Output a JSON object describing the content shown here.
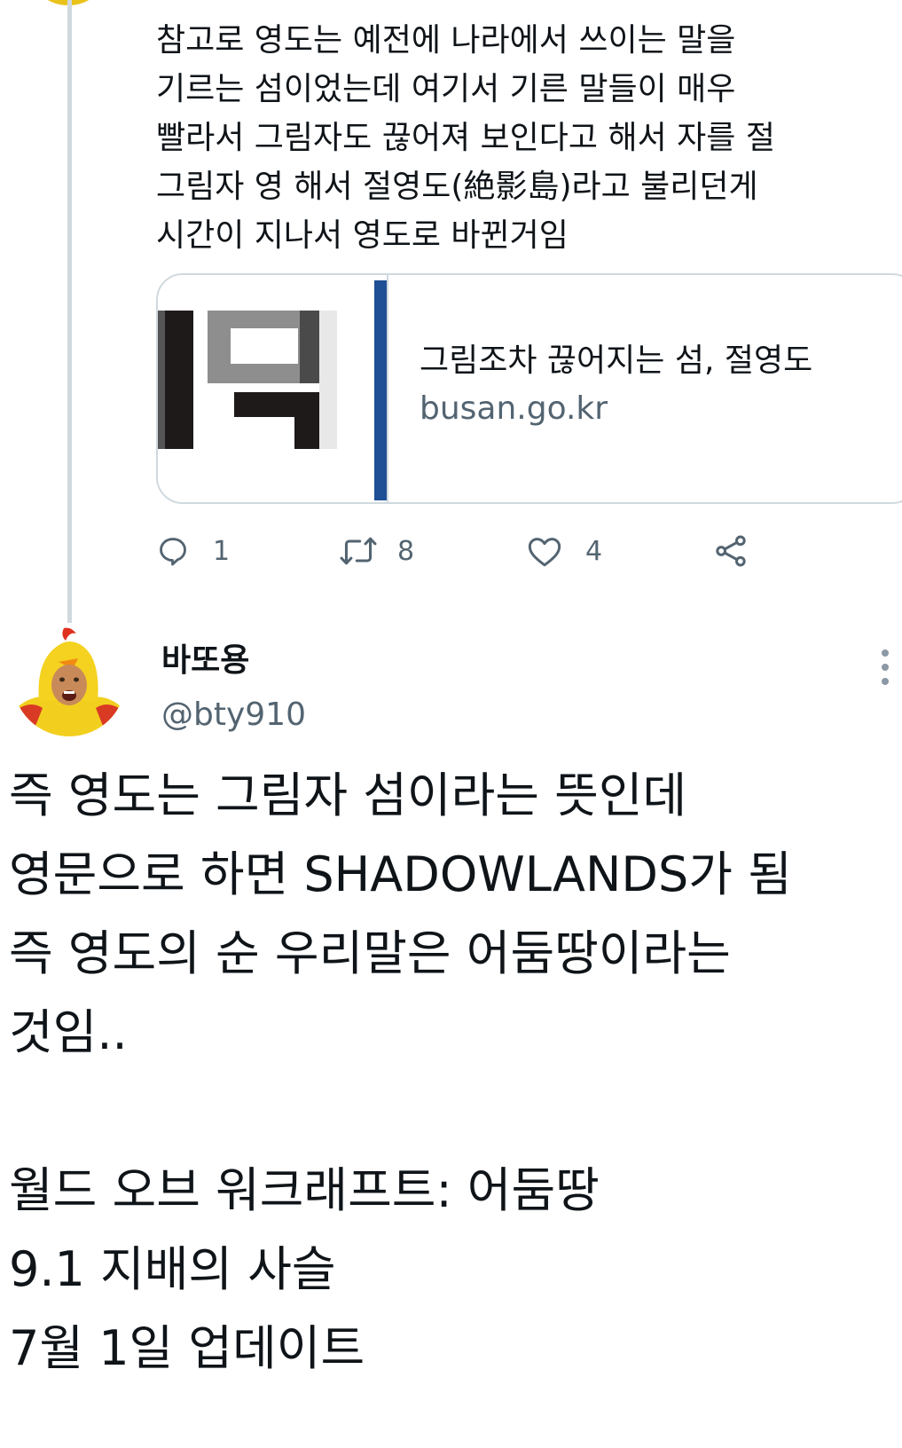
{
  "reply_context": {
    "text": "참고로 영도는 예전에 나라에서 쓰이는 말을\n기르는 섬이었는데 여기서 기른 말들이 매우\n빨라서 그림자도 끊어져 보인다고 해서 자를 절\n그림자 영 해서 절영도(絶影島)라고 불리던게\n시간이 지나서 영도로 바뀐거임",
    "link_card": {
      "title": "그림조차 끊어지는 섬, 절영도",
      "domain": "busan.go.kr"
    },
    "actions": {
      "reply_count": "1",
      "retweet_count": "8",
      "like_count": "4"
    }
  },
  "tweet": {
    "author_name": "바또용",
    "author_handle": "@bty910",
    "text": "즉 영도는 그림자 섬이라는 뜻인데\n영문으로 하면 SHADOWLANDS가 됨\n즉 영도의 순 우리말은 어둠땅이라는\n것임..\n\n월드 오브 워크래프트: 어둠땅\n9.1 지배의 사슬\n7월 1일 업데이트"
  },
  "icons": {
    "reply": "speech-bubble-icon",
    "retweet": "retweet-arrows-icon",
    "like": "heart-icon",
    "share": "share-icon",
    "more": "vertical-dots-icon"
  },
  "colors": {
    "text": "#0f1419",
    "secondary": "#536471",
    "border": "#cfd9de",
    "thumb_accent": "#1f4f95"
  }
}
